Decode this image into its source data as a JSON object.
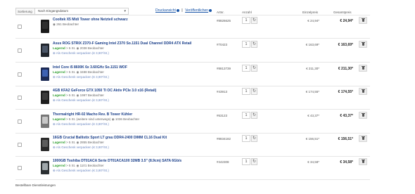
{
  "toolbar": {
    "sort_label": "Sortierung",
    "sort_value": "Nach Eingangsdatum",
    "print_link": "Druckansicht",
    "publish_link": "Veröffentlichen",
    "separator": "|"
  },
  "columns": {
    "article": "Artnr.",
    "quantity": "Anzahl",
    "unit_price": "Einzelpreis",
    "total_price": "Gesamtpreis"
  },
  "items": [
    {
      "title": "Cooltek X5 Midi Tower ohne Netzteil schwarz",
      "stock": "",
      "stock_sub": "",
      "watchers": "261 Beobachter",
      "gift": "",
      "artnr": "#8826625",
      "qty": "1",
      "unit": "€ 24,94*",
      "total": "€ 24,94*"
    },
    {
      "title": "Asus ROG STRIX Z370-F Gaming Intel Z370 So.1151 Dual Channel DDR4 ATX Retail",
      "stock": "Lagernd",
      "stock_sub": "> 5 St.",
      "watchers": "2038 Beobachter",
      "gift": "Als Geschenk verpacken (€ 3,90*/St.)",
      "artnr": "#70423",
      "qty": "1",
      "unit": "€ 163,69*",
      "total": "€ 163,69*"
    },
    {
      "title": "Intel Core i5 8600K 6x 3.60GHz So.1151 WOF",
      "stock": "Lagernd",
      "stock_sub": "> 5 St.",
      "watchers": "3488 Beobachter",
      "gift": "Als Geschenk verpacken (€ 3,90*/St.)",
      "artnr": "#8813739",
      "qty": "1",
      "unit": "€ 211,30*",
      "total": "€ 211,30*"
    },
    {
      "title": "4GB KFA2 GeForce GTX 1050 Ti OC Aktiv PCIe 3.0 x16 (Retail)",
      "stock": "Lagernd",
      "stock_sub": "> 5 St.",
      "watchers": "1997 Beobachter",
      "gift": "Als Geschenk verpacken (€ 3,90*/St.)",
      "artnr": "#43913",
      "qty": "1",
      "unit": "€ 174,55*",
      "total": "€ 174,55*"
    },
    {
      "title": "Thermalright HR-02 Macho Rev. B Tower Kühler",
      "stock": "Lagernd",
      "stock_sub": "> 5 St. (weitere sind unterwegs)",
      "watchers": "1036 Beobachter",
      "gift": "Als Geschenk verpacken (€ 3,90*/St.)",
      "artnr": "#63123",
      "qty": "1",
      "unit": "€ 43,37*",
      "total": "€ 43,37*"
    },
    {
      "title": "16GB Crucial Ballistix Sport LT grau DDR4-2400 DIMM CL16 Dual Kit",
      "stock": "Lagernd",
      "stock_sub": "> 5 St.",
      "watchers": "2855 Beobachter",
      "gift": "Als Geschenk verpacken (€ 3,90*/St.)",
      "artnr": "#8834182",
      "qty": "1",
      "unit": "€ 156,51*",
      "total": "€ 156,51*"
    },
    {
      "title": "1000GB Toshiba DT01ACA Serie DT01ACA100 32MB 3.5\" (8.9cm) SATA 6Gb/s",
      "stock": "Lagernd",
      "stock_sub": "> 5 St.",
      "watchers": "1101 Beobachter",
      "gift": "Als Geschenk verpacken (€ 3,90*/St.)",
      "artnr": "#442308",
      "qty": "1",
      "unit": "€ 34,58*",
      "total": "€ 34,58*"
    }
  ],
  "footer": {
    "label": "Bestellbare Dienstleistungen"
  }
}
